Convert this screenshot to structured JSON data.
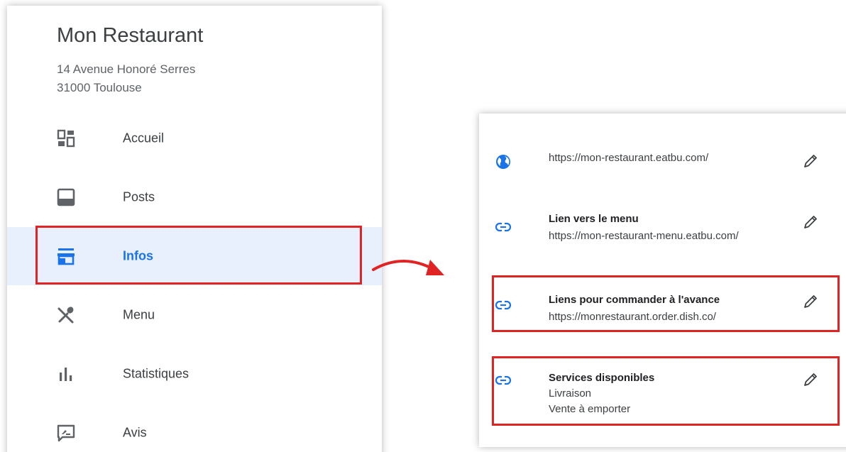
{
  "business": {
    "name": "Mon Restaurant",
    "address_line1": "14 Avenue Honoré Serres",
    "address_line2": "31000 Toulouse"
  },
  "nav": {
    "items": [
      {
        "label": "Accueil",
        "icon": "dashboard-icon"
      },
      {
        "label": "Posts",
        "icon": "posts-icon"
      },
      {
        "label": "Infos",
        "icon": "storefront-icon",
        "active": true
      },
      {
        "label": "Menu",
        "icon": "restaurant-icon"
      },
      {
        "label": "Statistiques",
        "icon": "bar-chart-icon"
      },
      {
        "label": "Avis",
        "icon": "reviews-icon"
      }
    ]
  },
  "info": {
    "website": {
      "icon": "globe-icon",
      "url": "https://mon-restaurant.eatbu.com/"
    },
    "menu_link": {
      "icon": "link-icon",
      "title": "Lien vers le menu",
      "url": "https://mon-restaurant-menu.eatbu.com/"
    },
    "order_link": {
      "icon": "link-icon",
      "title": "Liens pour commander à l'avance",
      "url": "https://monrestaurant.order.dish.co/"
    },
    "services": {
      "icon": "link-icon",
      "title": "Services disponibles",
      "items": [
        "Livraison",
        "Vente à emporter"
      ]
    }
  },
  "colors": {
    "accent": "#1a73e8",
    "active_bg": "#e8f0fe",
    "highlight": "#e02424",
    "icon_gray": "#5f6368"
  }
}
